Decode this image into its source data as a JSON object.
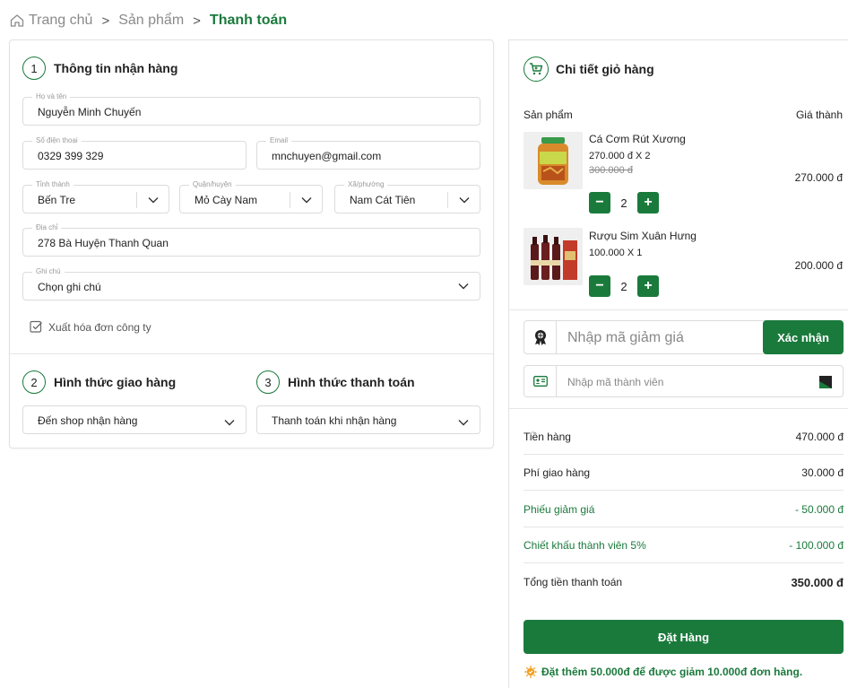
{
  "breadcrumb": {
    "home": "Trang chủ",
    "products": "Sản phẩm",
    "current": "Thanh toán"
  },
  "shipping_info": {
    "step": "1",
    "title": "Thông tin nhận hàng",
    "name_label": "Họ và tên",
    "name_value": "Nguyễn Minh Chuyến",
    "phone_label": "Số điện thoại",
    "phone_value": "0329 399 329",
    "email_label": "Email",
    "email_value": "mnchuyen@gmail.com",
    "province_label": "Tỉnh thành",
    "province_value": "Bến Tre",
    "district_label": "Quận/huyện",
    "district_value": "Mỏ Cày Nam",
    "ward_label": "Xã/phường",
    "ward_value": "Nam Cát Tiên",
    "address_label": "Địa chỉ",
    "address_value": "278 Bà Huyện Thanh Quan",
    "note_label": "Ghi chú",
    "note_value": "Chọn ghi chú",
    "invoice_label": "Xuất hóa đơn công ty"
  },
  "delivery": {
    "step": "2",
    "title": "Hình thức giao hàng",
    "value": "Đến shop nhận hàng"
  },
  "payment": {
    "step": "3",
    "title": "Hình thức thanh toán",
    "value": "Thanh toán khi nhận hàng"
  },
  "cart": {
    "title": "Chi tiết giỏ hàng",
    "col_product": "Sản phẩm",
    "col_price": "Giá thành",
    "items": [
      {
        "name": "Cá Cơm Rút Xương",
        "price_line": "270.000 đ   X   2",
        "old_price": "300.000 đ",
        "total": "270.000 đ",
        "qty": "2"
      },
      {
        "name": "Rượu Sim Xuân Hưng",
        "price_line": "100.000   X   1",
        "old_price": "",
        "total": "200.000 đ",
        "qty": "2"
      }
    ],
    "coupon_placeholder": "Nhập mã giảm giá",
    "coupon_confirm": "Xác nhận",
    "member_placeholder": "Nhập mã thành viên"
  },
  "summary": {
    "subtotal_label": "Tiền hàng",
    "subtotal_value": "470.000 đ",
    "shipping_label": "Phí giao hàng",
    "shipping_value": "30.000 đ",
    "voucher_label": "Phiếu giảm giá",
    "voucher_value": "- 50.000 đ",
    "member_label": "Chiết khấu thành viên  5%",
    "member_value": "- 100.000 đ",
    "total_label": "Tổng tiền thanh toán",
    "total_value": "350.000 đ"
  },
  "order_button": "Đặt Hàng",
  "promo_note": "Đặt thêm 50.000đ để được giảm 10.000đ đơn hàng.",
  "colors": {
    "accent": "#1a7a3c",
    "border": "#dcdcdc",
    "muted_text": "#8a8a8a"
  }
}
